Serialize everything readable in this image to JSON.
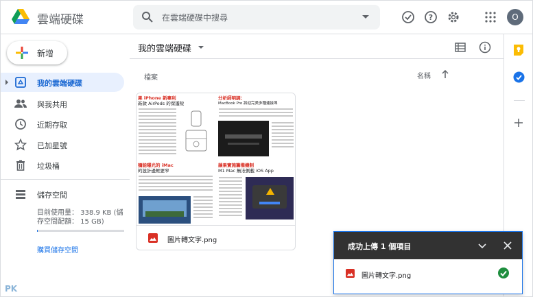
{
  "app": {
    "title": "雲端硬碟"
  },
  "search": {
    "placeholder": "在雲端硬碟中搜尋"
  },
  "header": {
    "avatar_letter": "O"
  },
  "sidebar": {
    "new_label": "新增",
    "items": [
      {
        "label": "我的雲端硬碟",
        "icon": "my-drive-icon",
        "active": true
      },
      {
        "label": "與我共用",
        "icon": "shared-people-icon"
      },
      {
        "label": "近期存取",
        "icon": "clock-icon"
      },
      {
        "label": "已加星號",
        "icon": "star-icon"
      },
      {
        "label": "垃圾桶",
        "icon": "trash-icon"
      }
    ],
    "storage": {
      "label": "儲存空間",
      "usage_text": "目前使用量： 338.9 KB (儲存空間配額： 15 GB)",
      "usage_fraction": 0.0001,
      "buy_label": "購買儲存空間"
    }
  },
  "main": {
    "title": "我的雲端硬碟",
    "column_label": "檔案",
    "sort_label": "名稱",
    "files": [
      {
        "name": "圖片轉文字.png",
        "thumb": {
          "q1_title": "果 iPhone 新專利",
          "q1_sub": "新款 AirPods 的保護殼",
          "q2_title": "分析師明調：",
          "q2_sub": "MacBook Pro 將迎完美多種連接埠",
          "q3_title": "彌能曝光的 iMac",
          "q3_sub": "的設計邊框更窄",
          "q4_title": "蘋果實施籌備機制",
          "q4_sub": "M1 Mac 無法側載 iOS App"
        }
      }
    ]
  },
  "toast": {
    "title": "成功上傳 1 個項目",
    "file_name": "圖片轉文字.png"
  },
  "watermark": "PK",
  "colors": {
    "accent": "#1a73e8",
    "active_bg": "#e8f0fe",
    "toast_header": "#323232",
    "success": "#1e8e3e",
    "file_red": "#d93025"
  }
}
